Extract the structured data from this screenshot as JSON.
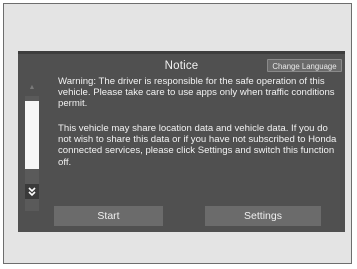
{
  "dialog": {
    "title": "Notice",
    "change_language_label": "Change Language",
    "paragraph1": "Warning: The driver is responsible for the safe operation of this vehicle. Please take care to use apps only when traffic conditions permit.",
    "paragraph2": "This vehicle may share location data and vehicle data. If you do not wish to share this data or if you have not subscribed to Honda connected services, please click Settings and switch this function off.",
    "start_label": "Start",
    "settings_label": "Settings"
  },
  "scrollbar": {
    "up_icon": "arrow-up-icon",
    "down_icon": "double-chevron-down-icon",
    "position_fraction": 0.05
  },
  "colors": {
    "screen_bg": "#505050",
    "button_bg": "#6b6b6b",
    "frame_bg": "#e4e4e4",
    "text": "#f2f2f2"
  }
}
